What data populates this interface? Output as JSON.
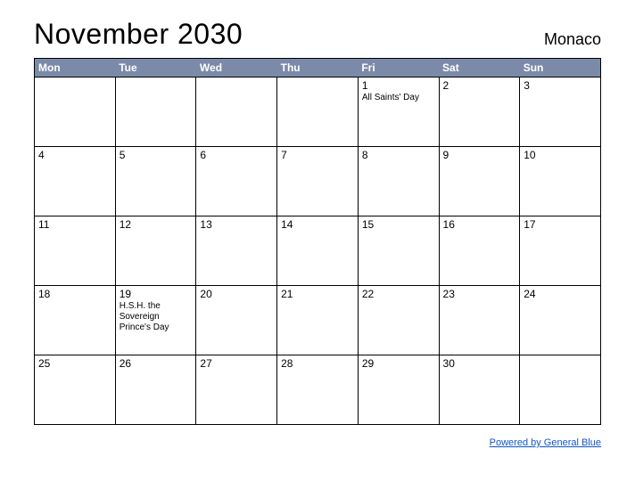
{
  "header": {
    "title": "November 2030",
    "region": "Monaco"
  },
  "weekdays": [
    "Mon",
    "Tue",
    "Wed",
    "Thu",
    "Fri",
    "Sat",
    "Sun"
  ],
  "weeks": [
    [
      {
        "day": "",
        "event": ""
      },
      {
        "day": "",
        "event": ""
      },
      {
        "day": "",
        "event": ""
      },
      {
        "day": "",
        "event": ""
      },
      {
        "day": "1",
        "event": "All Saints' Day"
      },
      {
        "day": "2",
        "event": ""
      },
      {
        "day": "3",
        "event": ""
      }
    ],
    [
      {
        "day": "4",
        "event": ""
      },
      {
        "day": "5",
        "event": ""
      },
      {
        "day": "6",
        "event": ""
      },
      {
        "day": "7",
        "event": ""
      },
      {
        "day": "8",
        "event": ""
      },
      {
        "day": "9",
        "event": ""
      },
      {
        "day": "10",
        "event": ""
      }
    ],
    [
      {
        "day": "11",
        "event": ""
      },
      {
        "day": "12",
        "event": ""
      },
      {
        "day": "13",
        "event": ""
      },
      {
        "day": "14",
        "event": ""
      },
      {
        "day": "15",
        "event": ""
      },
      {
        "day": "16",
        "event": ""
      },
      {
        "day": "17",
        "event": ""
      }
    ],
    [
      {
        "day": "18",
        "event": ""
      },
      {
        "day": "19",
        "event": "H.S.H. the Sovereign Prince's Day"
      },
      {
        "day": "20",
        "event": ""
      },
      {
        "day": "21",
        "event": ""
      },
      {
        "day": "22",
        "event": ""
      },
      {
        "day": "23",
        "event": ""
      },
      {
        "day": "24",
        "event": ""
      }
    ],
    [
      {
        "day": "25",
        "event": ""
      },
      {
        "day": "26",
        "event": ""
      },
      {
        "day": "27",
        "event": ""
      },
      {
        "day": "28",
        "event": ""
      },
      {
        "day": "29",
        "event": ""
      },
      {
        "day": "30",
        "event": ""
      },
      {
        "day": "",
        "event": ""
      }
    ]
  ],
  "footer": {
    "link_text": "Powered by General Blue"
  }
}
